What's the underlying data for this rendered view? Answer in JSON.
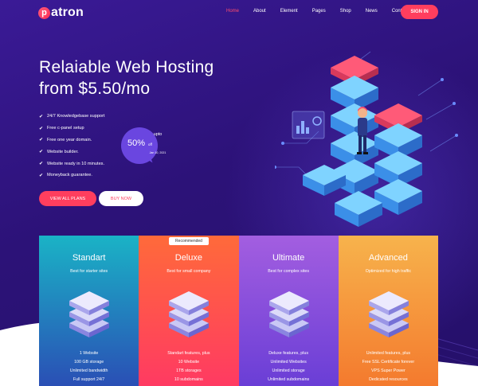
{
  "brand": {
    "logo_letter": "p",
    "logo_text": "atron"
  },
  "nav": {
    "items": [
      "Home",
      "About",
      "Element",
      "Pages",
      "Shop",
      "News",
      "Contact"
    ],
    "active": "Home",
    "signin_label": "SIGN IN"
  },
  "hero": {
    "title_line1": "Relaiable Web Hosting",
    "title_line2": "from $5.50/mo",
    "features": [
      "24/7 Knowledgebase support",
      "Free c-panel setup",
      "Free one year domain.",
      "Website builder.",
      "Website ready in 10 minutes.",
      "Moneyback guarantee."
    ],
    "badge": {
      "upto": "upto",
      "percent": "50%",
      "off": "off",
      "date": "Jan 10, 2021"
    },
    "primary_button": "VIEW ALL PLANS",
    "secondary_button": "BUY NOW"
  },
  "pricing": {
    "recommended_label": "Recommended",
    "plans": [
      {
        "name": "Standart",
        "subtitle": "Best for starter sites",
        "features": [
          "1 Website",
          "100 GB storage",
          "Unlimited bandwidth",
          "Full support 24/7"
        ]
      },
      {
        "name": "Deluxe",
        "subtitle": "Best for small company",
        "features": [
          "Standart features, plus",
          "10 Website",
          "1TB storages",
          "10 subdomains"
        ]
      },
      {
        "name": "Ultimate",
        "subtitle": "Best for complex sites",
        "features": [
          "Deluxe features, plus",
          "Unlimited Websites",
          "Unlimited storage",
          "Unlimited subdomains"
        ]
      },
      {
        "name": "Advanced",
        "subtitle": "Optimized for high traffic",
        "features": [
          "Unlimited features, plus",
          "Free SSL Certificate forever",
          "VPS Super Power",
          "Dedicated resources"
        ]
      }
    ]
  },
  "colors": {
    "accent": "#ff3e5e",
    "background": "#2c1278",
    "standart": "#1ab3c6",
    "deluxe": "#ff5a4a",
    "ultimate": "#8e4fe0",
    "advanced": "#f59a3c"
  },
  "icons": [
    "check-icon",
    "server-stack-icon",
    "server-illustration"
  ]
}
